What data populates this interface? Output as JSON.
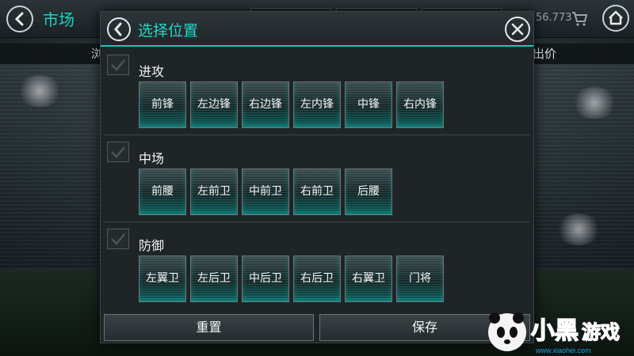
{
  "background_screen": {
    "title": "市场",
    "coins": "56.773",
    "sub_left": "浏",
    "sub_right": "出价",
    "icons": [
      "back-arrow-icon",
      "cart-icon",
      "home-icon"
    ]
  },
  "modal": {
    "title": "选择位置",
    "icons": {
      "back": "chevron-left-icon",
      "close": "close-icon"
    },
    "sections": [
      {
        "label": "进攻",
        "checked": false,
        "positions": [
          "前锋",
          "左边锋",
          "右边锋",
          "左内锋",
          "中锋",
          "右内锋"
        ]
      },
      {
        "label": "中场",
        "checked": false,
        "positions": [
          "前腰",
          "左前卫",
          "中前卫",
          "右前卫",
          "后腰"
        ]
      },
      {
        "label": "防御",
        "checked": false,
        "positions": [
          "左翼卫",
          "左后卫",
          "中后卫",
          "右后卫",
          "右翼卫",
          "门将"
        ]
      }
    ],
    "footer": {
      "reset_label": "重置",
      "save_label": "保存"
    }
  },
  "watermark": {
    "text": "小黑游戏",
    "url": "www.xiaohei.com"
  },
  "colors": {
    "accent": "#17c9c0",
    "title": "#22d6c9",
    "modal_bg": "#1f2527"
  }
}
